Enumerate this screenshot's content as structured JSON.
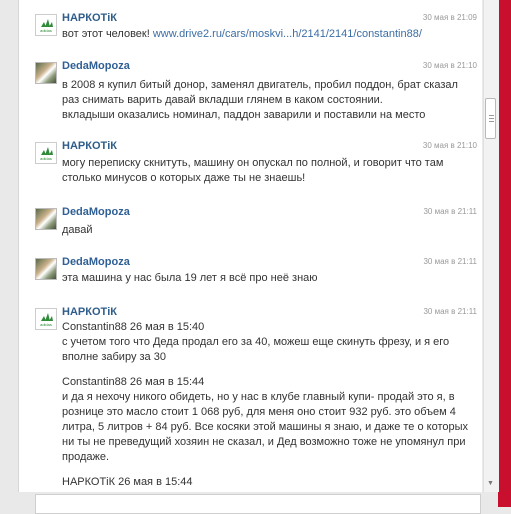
{
  "messages": [
    {
      "author": "НАРКОТiК",
      "time": "30 мая в 21:09",
      "avatar": "adidas-logo",
      "lines": [],
      "prefix": "вот этот человек! ",
      "link": "www.drive2.ru/cars/moskvi...h/2141/2141/constantin88/"
    },
    {
      "author": "DedaMopoza",
      "time": "30 мая в 21:10",
      "avatar": "user-photo",
      "lines": [
        "в 2008 я купил битый донор, заменял двигатель, пробил поддон, брат сказал",
        "раз снимать варить давай вкладши глянем в каком состоянии.",
        "вкладыши оказались номинал, паддон заварили и поставили на место"
      ]
    },
    {
      "author": "НАРКОТiК",
      "time": "30 мая в 21:10",
      "avatar": "adidas-logo",
      "lines": [
        "могу переписку скнитуть, машину он опускал по полной, и говорит что там",
        "столько минусов о которых даже ты не знаешь!"
      ]
    },
    {
      "author": "DedaMopoza",
      "time": "30 мая в 21:11",
      "avatar": "user-photo",
      "lines": [
        "давай"
      ]
    },
    {
      "author": "DedaMopoza",
      "time": "30 мая в 21:11",
      "avatar": "user-photo",
      "lines": [
        "эта машина у нас была 19 лет я всё про неё знаю"
      ]
    },
    {
      "author": "НАРКОТiК",
      "time": "30 мая в 21:11",
      "avatar": "adidas-logo",
      "lines": [
        "Constantin88 26 мая в 15:40",
        "с учетом того что Деда продал его за 40, можеш еще скинуть фрезу, и я его",
        "вполне забиру за 30",
        "",
        "Constantin88 26 мая в 15:44",
        "и да я нехочу никого обидеть, но у нас в клубе главный купи- продай это я, в",
        "рознице это масло стоит 1 068 руб, для меня оно стоит 932 руб. это объем 4",
        "литра, 5 литров + 84 руб. Все косяки этой машины я знаю, и даже те о которых",
        "ни ты не преведущий хозяин не сказал, и Дед возможно тоже не упомянул при",
        "продаже.",
        "",
        "НАРКОТiК 26 мая в 15:44"
      ]
    }
  ],
  "colors": {
    "accent": "#c8102e",
    "author": "#2e5d8a",
    "link": "#3b6ea5"
  }
}
